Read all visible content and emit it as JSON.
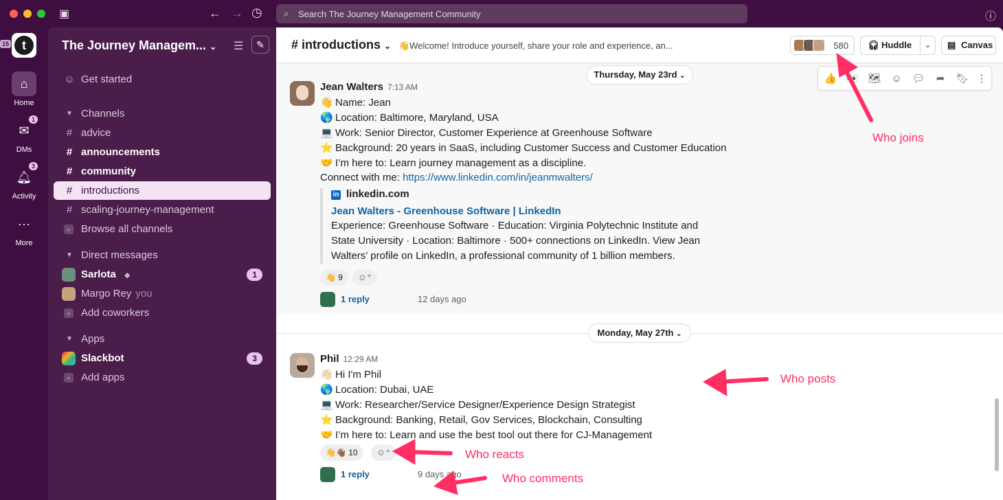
{
  "window": {
    "search_placeholder": "Search The Journey Management Community"
  },
  "rail": {
    "workspace_badge": "15",
    "workspace_letter": "t",
    "items": [
      {
        "label": "Home",
        "badge": ""
      },
      {
        "label": "DMs",
        "badge": "1"
      },
      {
        "label": "Activity",
        "badge": "3"
      },
      {
        "label": "More",
        "badge": ""
      }
    ]
  },
  "sidebar": {
    "workspace_name": "The Journey Managem...",
    "get_started": "Get started",
    "channels_header": "Channels",
    "channels": [
      {
        "name": "advice",
        "bold": false
      },
      {
        "name": "announcements",
        "bold": true
      },
      {
        "name": "community",
        "bold": true
      },
      {
        "name": "introductions",
        "active": true
      },
      {
        "name": "scaling-journey-management",
        "bold": false
      }
    ],
    "browse_channels": "Browse all channels",
    "dm_header": "Direct messages",
    "dms": [
      {
        "name": "Sarlota",
        "badge": "1"
      },
      {
        "name": "Margo Rey",
        "suffix": "you"
      }
    ],
    "add_coworkers": "Add coworkers",
    "apps_header": "Apps",
    "apps": [
      {
        "name": "Slackbot",
        "badge": "3"
      }
    ],
    "add_apps": "Add apps"
  },
  "channel": {
    "name": "# introductions",
    "topic": "👋Welcome! Introduce yourself, share your role and experience, an...",
    "member_count": "580",
    "huddle_label": "Huddle",
    "canvas_label": "Canvas"
  },
  "dates": [
    "Thursday, May 23rd",
    "Monday, May 27th"
  ],
  "messages": [
    {
      "author": "Jean Walters",
      "time": "7:13 AM",
      "lines": [
        {
          "emoji": "👋",
          "text": "Name: Jean"
        },
        {
          "emoji": "🌎",
          "text": "Location: Baltimore, Maryland, USA"
        },
        {
          "emoji": "💻",
          "text": "Work: Senior Director, Customer Experience at Greenhouse Software"
        },
        {
          "emoji": "⭐",
          "text": "Background: 20 years in SaaS, including Customer Success and Customer Education"
        },
        {
          "emoji": "🤝",
          "text": "I’m here to: Learn journey management as a discipline."
        }
      ],
      "connect_prefix": "Connect with me: ",
      "connect_link": "https://www.linkedin.com/in/jeanmwalters/",
      "unfurl": {
        "site": "linkedin.com",
        "title": "Jean Walters - Greenhouse Software | LinkedIn",
        "description": "Experience: Greenhouse Software · Education: Virginia Polytechnic Institute and State University · Location: Baltimore · 500+ connections on LinkedIn. View Jean Walters’ profile on LinkedIn, a professional community of 1 billion members."
      },
      "reaction": "👋 9",
      "reply_label": "1 reply",
      "reply_ago": "12 days ago"
    },
    {
      "author": "Phil",
      "time": "12:29 AM",
      "lines": [
        {
          "emoji": "👋🏻",
          "text": "Hi I'm Phil"
        },
        {
          "emoji": "🌎",
          "text": "Location: Dubai, UAE"
        },
        {
          "emoji": "💻",
          "text": "Work: Researcher/Service Designer/Experience Design Strategist"
        },
        {
          "emoji": "⭐",
          "text": "Background: Banking, Retail, Gov Services, Blockchain, Consulting"
        },
        {
          "emoji": "🤝",
          "text": "I’m here to: Learn and use the best tool out there for CJ-Management"
        }
      ],
      "reaction": "👋👋🏾 10",
      "reply_label": "1 reply",
      "reply_ago": "9 days ago"
    }
  ],
  "annotations": {
    "joins": "Who joins",
    "posts": "Who posts",
    "reacts": "Who reacts",
    "comments": "Who comments"
  },
  "colors": {
    "aubergine": "#3f0e40",
    "sidebar": "#4a1d4b",
    "link": "#1264a3",
    "annotation": "#ff2e63"
  }
}
